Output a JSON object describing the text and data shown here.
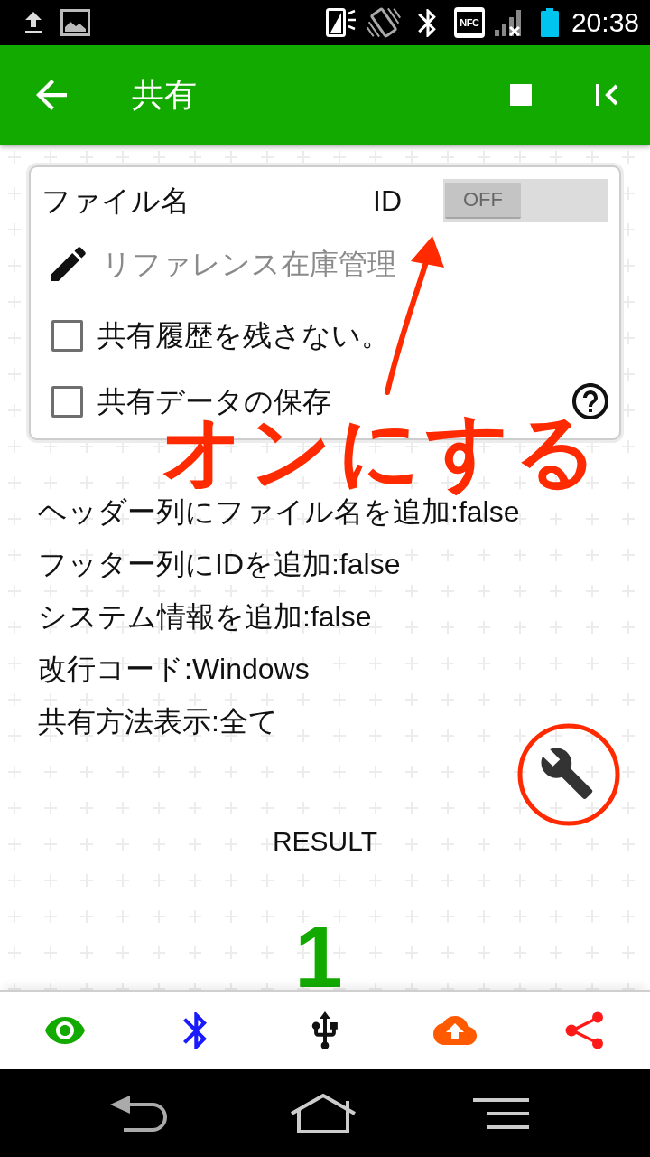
{
  "status_bar": {
    "nfc_label": "NFC",
    "time": "20:38"
  },
  "app_bar": {
    "title": "共有"
  },
  "share_card": {
    "file_name_label": "ファイル名",
    "id_label": "ID",
    "id_toggle": {
      "on": false,
      "label": "OFF"
    },
    "file_name_field": {
      "placeholder": "リファレンス在庫管理"
    },
    "options": [
      {
        "label": "共有履歴を残さない。",
        "checked": false
      },
      {
        "label": "共有データの保存",
        "checked": false
      }
    ]
  },
  "settings_summary": [
    "ヘッダー列にファイル名を追加:false",
    "フッター列にIDを追加:false",
    "システム情報を追加:false",
    "改行コード:Windows",
    "共有方法表示:全て"
  ],
  "result": {
    "label": "RESULT",
    "value": "1"
  },
  "annotation": {
    "text": "オンにする"
  }
}
